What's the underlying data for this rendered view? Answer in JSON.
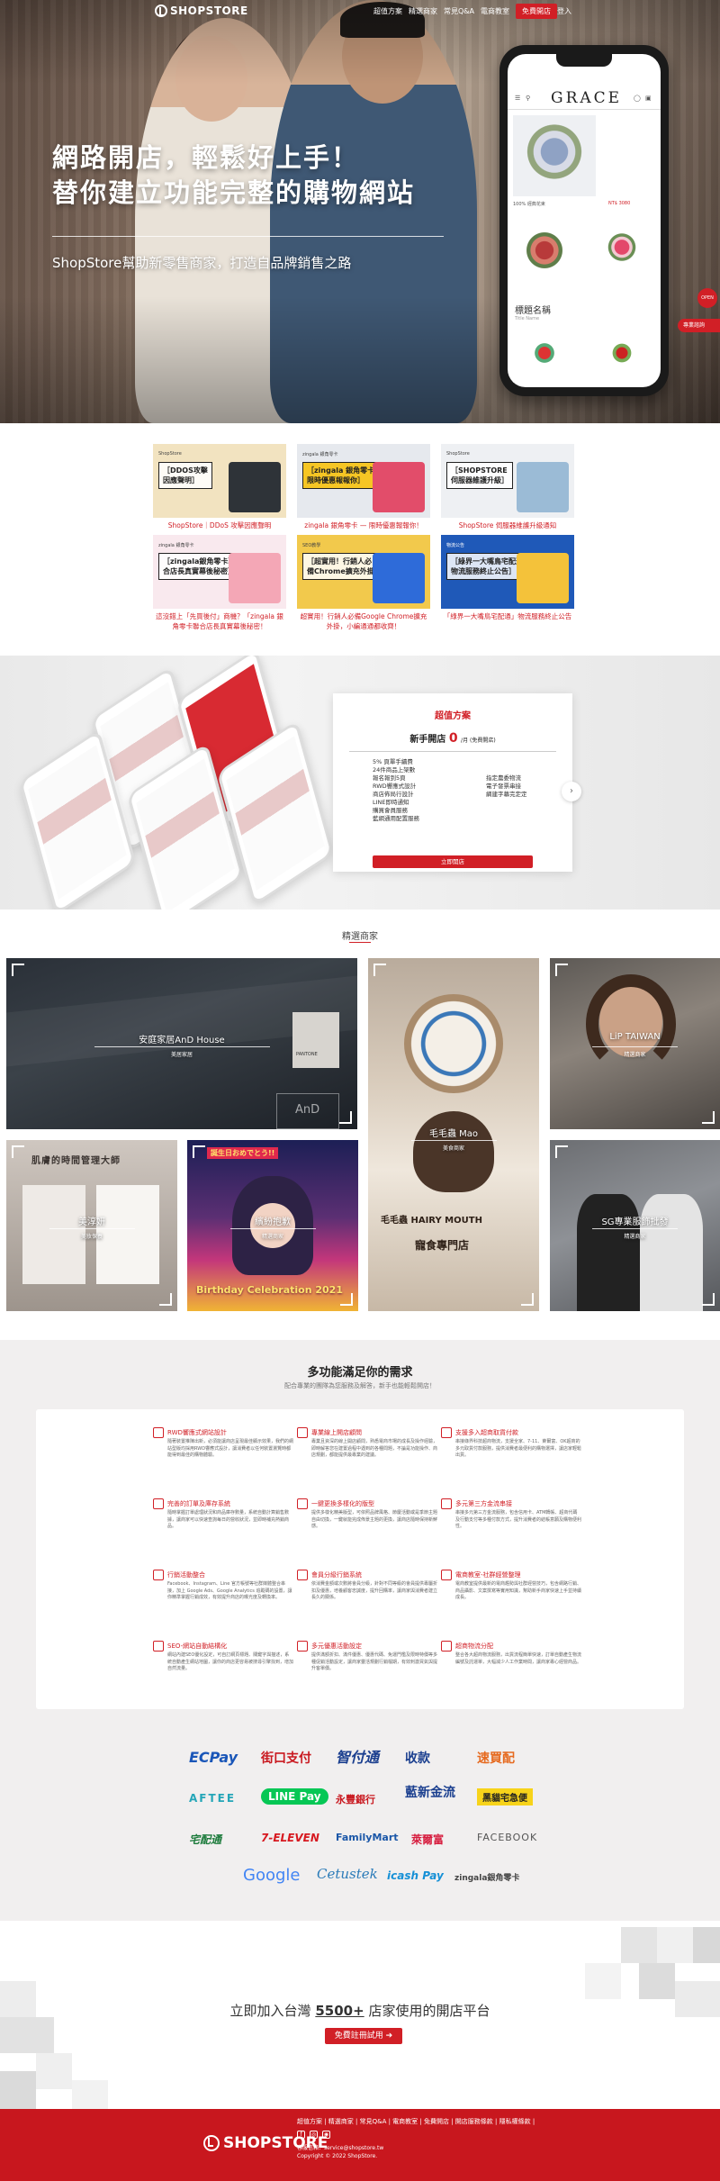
{
  "header": {
    "logo": "SHOPSTORE",
    "nav": [
      "超值方案",
      "精選商家",
      "常見Q&A",
      "電商教室"
    ],
    "free_trial": "免費開店",
    "login": "登入"
  },
  "hero": {
    "title_line1": "網路開店，輕鬆好上手！",
    "title_line2": "替你建立功能完整的購物網站",
    "subtitle": "ShopStore幫助新零售商家，打造自品牌銷售之路",
    "phone": {
      "brand": "GRACE",
      "product_name": "100% 經典花束",
      "product_price": "NT$ 3080",
      "section_title": "標題名稱",
      "section_subtitle": "Title Name"
    },
    "side_open": "OPEN",
    "side_consult": "專業諮詢"
  },
  "news": [
    {
      "tag": "ShopStore",
      "box": "［DDOS攻擊\n因應聲明］",
      "caption": "ShopStore｜DDoS 攻擊因應聲明",
      "color": "#2e3338",
      "bg": "#f2e3c0"
    },
    {
      "tag": "zingala 銀角零卡",
      "box": "［zingala 銀角零卡\n限時優惠報報你］",
      "caption": "zingala 銀角零卡 — 限時優惠報報你！",
      "color": "#f6c624",
      "bg": "#e6e9ee"
    },
    {
      "tag": "ShopStore",
      "box": "［SHOPSTORE\n伺服器維護升級］",
      "caption": "ShopStore 伺服器維護升級通知",
      "color": "#9bbbd6",
      "bg": "#eef0f3"
    },
    {
      "tag": "zingala 銀角零卡",
      "box": "［zingala銀角零卡聯\n合店長真實幕後秘密］",
      "caption": "這沒錯上「先買後付」商機？「zingala 銀角零卡聯合店長真實幕後秘密！",
      "color": "#f4a7b6",
      "bg": "#f9e9ee"
    },
    {
      "tag": "SEO教學",
      "box": "［超實用！行銷人必\n備Chrome擴充外掛］",
      "caption": "超實用！行銷人必備Google Chrome擴充外掛，小編通通都收齊！",
      "color": "#2e6bd9",
      "bg": "#f2c94c"
    },
    {
      "tag": "物流公告",
      "box": "［綠界一大嘴鳥宅配通\n物流服務終止公告］",
      "caption": "「綠界一大嘴鳥宅配通」物流服務終止公告",
      "color": "#1f59b8",
      "bg": "#f4c23a"
    }
  ],
  "plan": {
    "heading": "超值方案",
    "name": "新手開店",
    "price": "0",
    "unit": "/月 (免費開店)",
    "features_col1": [
      "5% 頁單手續費",
      "24件商品上架數",
      "報名報到5頁",
      "RWD響應式設計",
      "商店佈局行設計",
      "LINE即時通知",
      "購買會員服務",
      "藍網通用配置服務"
    ],
    "features_col2": [
      "指定農委物流",
      "電子發票串接",
      "綢建字幕完定定"
    ],
    "button": "立即開店"
  },
  "merchants": {
    "title": "精選商家",
    "items": [
      {
        "name": "安庭家居AnD House",
        "category": "美居家居"
      },
      {
        "name": "毛毛蟲 Mao",
        "category": "美食商家"
      },
      {
        "name": "LiP TAIWAN",
        "category": "精選商家"
      },
      {
        "name": "美淳妍",
        "category": "美妝保養"
      },
      {
        "name": "繽紛抱歉",
        "category": "精選商家"
      },
      {
        "name": "SG專業服飾批發",
        "category": "精選商家"
      }
    ],
    "and_tiles": [
      "PANTONE",
      "AnD"
    ],
    "mao_sign": "毛毛蟲 HAIRY MOUTH",
    "mao_sub": "寵食專門店",
    "anime_banner": "Birthday Celebration 2021",
    "beauty_banner": "肌膚的時間管理大師",
    "anime_top": "誕生日おめでとう!!"
  },
  "features": {
    "title": "多功能滿足你的需求",
    "subtitle": "配合專業的團隊為您服務及解答，新手也能輕鬆開店！",
    "items": [
      {
        "title": "RWD響應式網站設計",
        "text": "隨著裝置推陳出新，必須能讓商店呈現最佳顯示效果，我們的網站型版均採用RWD響應式設計，讓消費者以任何裝置瀏覽時都能得到最佳的購物體驗。"
      },
      {
        "title": "專業線上開店顧問",
        "text": "專業且資深的線上開店顧問，熟悉電商市場的成長及操作經驗，即時解答您在建置過程中遇到的各種問題，不論是功能操作、商店規劃，都能提供最專業的建議。"
      },
      {
        "title": "支援多入超商取貨付款",
        "text": "串接綠界科技超商物流，支援全家、7-11、萊爾富、OK超商的多元取貨付款服務，提供消費者最便利的購物選擇，讓店家輕鬆出貨。"
      },
      {
        "title": "完善的訂單及庫存系統",
        "text": "隨時掌握訂單處理狀況和商品庫存數量，系統自動計算銷售數據，讓商家可以快速查詢每日的營收狀況，並即時補充熱銷商品。"
      },
      {
        "title": "一鍵更換多樣化的版型",
        "text": "提供多樣化精美版型，可依照品牌風格、節慶活動或是季節主題自由切換，一鍵就能完成佈景主題的更換，讓商店隨時保持新鮮感。"
      },
      {
        "title": "多元第三方金流串接",
        "text": "串接多元第三方金流服務，包含信用卡、ATM轉帳、超商代碼及行動支付等多種付款方式，提升消費者的結帳意願及購物便利性。"
      },
      {
        "title": "行銷活動整合",
        "text": "Facebook、Instagram、Line 官方帳號等社群媒體整合串接，加上 Google Ads、Google Analytics 追蹤碼的設置，讓你精準掌握行銷成效，有效提升商店的曝光度及轉換率。"
      },
      {
        "title": "會員分級行銷系統",
        "text": "依消費金額或次數將會員分級，針對不同等級的會員提供專屬折扣及優惠，培養顧客忠誠度，提升回購率，讓商家與消費者建立長久的關係。"
      },
      {
        "title": "電商教室-社群經營整理",
        "text": "電商教室提供最新的電商趨勢與社群經營技巧，包含網路行銷、商品攝影、文案撰寫等實用知識，幫助新手商家快速上手並持續成長。"
      },
      {
        "title": "SEO-網站自動結構化",
        "text": "網站內建SEO優化設定，可自訂網頁標題、關鍵字與描述，系統自動產生網站地圖，讓你的商店更容易被搜尋引擎找到，增加自然流量。"
      },
      {
        "title": "多元優惠活動設定",
        "text": "提供滿額折扣、滿件優惠、優惠代碼、免運門檻及限時特價等多種促銷活動設定，讓商家靈活規劃行銷檔期，有效刺激買氣與提升客單價。"
      },
      {
        "title": "超商物流分配",
        "text": "整合各大超商物流服務，出貨流程簡單快速，訂單自動產生物流編號及託運單，大幅減少人工作業時間，讓商家專心經營商品。"
      }
    ]
  },
  "payments": [
    [
      "ECPay",
      "街口支付",
      "智付通",
      "收款",
      "速買配"
    ],
    [
      "AFTEE",
      "LINE Pay",
      "永豐銀行",
      "藍新金流",
      "黑貓宅急便"
    ],
    [
      "宅配通",
      "7-ELEVEN",
      "FamilyMart",
      "萊爾富",
      "FACEBOOK"
    ],
    [
      "Google",
      "Cetustek",
      "icash Pay",
      "zingala銀角零卡"
    ]
  ],
  "cta": {
    "prefix": "立即加入台灣",
    "number": "5500+",
    "suffix": "店家使用的開店平台",
    "button": "免費註冊試用 ➔"
  },
  "footer": {
    "logo": "SHOPSTORE",
    "links": "超值方案 | 精選商家 | 常見Q&A | 電商教室 | 免費開店 | 開店服務條款 | 隱私權條款 |",
    "contact_email": "客服信箱：service@shopstore.tw",
    "copyright": "Copyright © 2022 ShopStore."
  }
}
